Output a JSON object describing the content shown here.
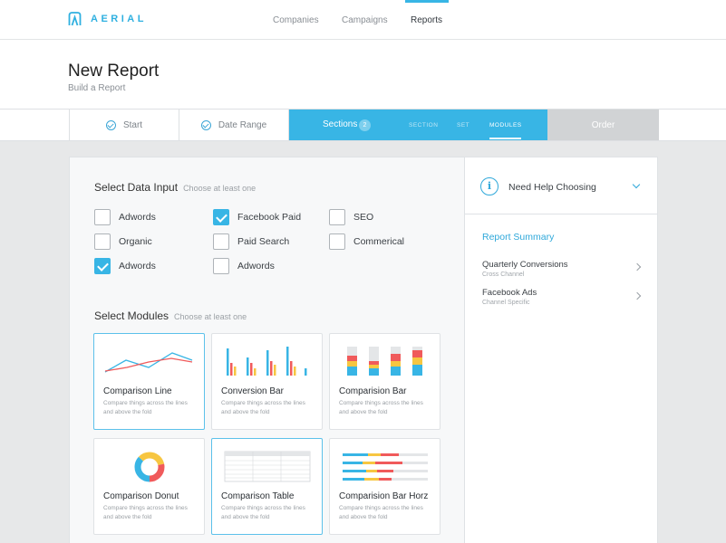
{
  "app": {
    "name": "AERIAL"
  },
  "nav": {
    "items": [
      {
        "label": "Companies"
      },
      {
        "label": "Campaigns"
      },
      {
        "label": "Reports"
      }
    ],
    "active": "Reports"
  },
  "page": {
    "title": "New Report",
    "subtitle": "Build a Report"
  },
  "steps": {
    "start": "Start",
    "date_range": "Date Range",
    "sections": {
      "label": "Sections",
      "badge": "2",
      "subs": [
        "SECTION",
        "SET",
        "MODULES"
      ],
      "active_sub": "MODULES"
    },
    "order": "Order"
  },
  "data_input": {
    "title": "Select Data Input",
    "hint": "Choose at least one",
    "options": [
      {
        "label": "Adwords",
        "checked": false
      },
      {
        "label": "Organic",
        "checked": false
      },
      {
        "label": "Adwords",
        "checked": true
      },
      {
        "label": "Facebook Paid",
        "checked": true
      },
      {
        "label": "Paid Search",
        "checked": false
      },
      {
        "label": "Adwords",
        "checked": false
      },
      {
        "label": "SEO",
        "checked": false
      },
      {
        "label": "Commerical",
        "checked": false
      }
    ]
  },
  "modules": {
    "title": "Select Modules",
    "hint": "Choose at least one",
    "cards": [
      {
        "name": "Comparison Line",
        "desc": "Compare things across the lines and above the fold",
        "selected": true,
        "icon": "line-chart-icon"
      },
      {
        "name": "Conversion Bar",
        "desc": "Compare things across the lines and above the fold",
        "selected": false,
        "icon": "bar-chart-icon"
      },
      {
        "name": "Comparision Bar",
        "desc": "Compare things across the lines and above the fold",
        "selected": false,
        "icon": "stacked-bar-icon"
      },
      {
        "name": "Comparison Donut",
        "desc": "Compare things across the lines and above the fold",
        "selected": false,
        "icon": "donut-chart-icon"
      },
      {
        "name": "Comparison Table",
        "desc": "Compare things across the lines and above the fold",
        "selected": true,
        "icon": "table-icon"
      },
      {
        "name": "Comparision Bar Horz",
        "desc": "Compare things across the lines and above the fold",
        "selected": false,
        "icon": "horizontal-bar-icon"
      }
    ]
  },
  "sidebar": {
    "help": "Need Help Choosing",
    "summary_title": "Report Summary",
    "items": [
      {
        "title": "Quarterly Conversions",
        "sub": "Cross Channel"
      },
      {
        "title": "Facebook Ads",
        "sub": "Channel Specific"
      }
    ]
  },
  "colors": {
    "accent": "#38b5e5",
    "red": "#f05a5b",
    "yellow": "#f7c641",
    "order_bg": "#d1d3d5"
  }
}
